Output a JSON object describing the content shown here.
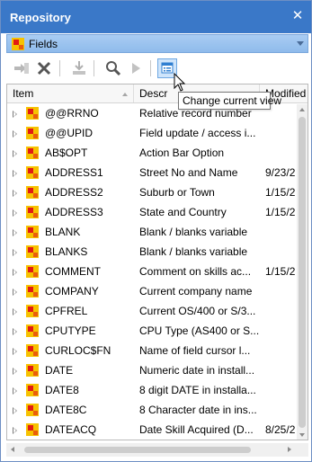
{
  "window": {
    "title": "Repository",
    "close_glyph": "✕"
  },
  "selector": {
    "value": "Fields",
    "icon": "field-icon"
  },
  "toolbar": {
    "buttons": [
      {
        "name": "open-item-icon",
        "enabled": false
      },
      {
        "name": "delete-icon",
        "enabled": true
      },
      {
        "name": "import-icon",
        "enabled": false
      },
      {
        "name": "search-icon",
        "enabled": true
      },
      {
        "name": "play-icon",
        "enabled": false
      },
      {
        "name": "change-view-icon",
        "enabled": true,
        "active": true
      }
    ],
    "tooltip": "Change current view"
  },
  "grid": {
    "columns": [
      "Item",
      "Descr",
      "Modified"
    ],
    "rows": [
      {
        "item": "@@RRNO",
        "desc": "Relative record number",
        "modified": ""
      },
      {
        "item": "@@UPID",
        "desc": "Field update / access i...",
        "modified": ""
      },
      {
        "item": "AB$OPT",
        "desc": "Action Bar Option",
        "modified": ""
      },
      {
        "item": "ADDRESS1",
        "desc": "Street No and Name",
        "modified": "9/23/2"
      },
      {
        "item": "ADDRESS2",
        "desc": "Suburb or Town",
        "modified": "1/15/2"
      },
      {
        "item": "ADDRESS3",
        "desc": "State and Country",
        "modified": "1/15/2"
      },
      {
        "item": "BLANK",
        "desc": "Blank / blanks variable",
        "modified": ""
      },
      {
        "item": "BLANKS",
        "desc": "Blank / blanks variable",
        "modified": ""
      },
      {
        "item": "COMMENT",
        "desc": "Comment on skills ac...",
        "modified": "1/15/2"
      },
      {
        "item": "COMPANY",
        "desc": "Current company name",
        "modified": ""
      },
      {
        "item": "CPFREL",
        "desc": "Current OS/400 or S/3...",
        "modified": ""
      },
      {
        "item": "CPUTYPE",
        "desc": "CPU Type (AS400 or S...",
        "modified": ""
      },
      {
        "item": "CURLOC$FN",
        "desc": "Name of field cursor l...",
        "modified": ""
      },
      {
        "item": "DATE",
        "desc": "Numeric date in install...",
        "modified": ""
      },
      {
        "item": "DATE8",
        "desc": "8 digit DATE in installa...",
        "modified": ""
      },
      {
        "item": "DATE8C",
        "desc": "8 Character date in ins...",
        "modified": ""
      },
      {
        "item": "DATEACQ",
        "desc": "Date Skill Acquired (D...",
        "modified": "8/25/2"
      }
    ]
  },
  "colors": {
    "title_bar": "#3a78c8",
    "selector_bar": "#9fc5f0",
    "icon_yellow": "#f6c200",
    "icon_red": "#e21b12"
  }
}
